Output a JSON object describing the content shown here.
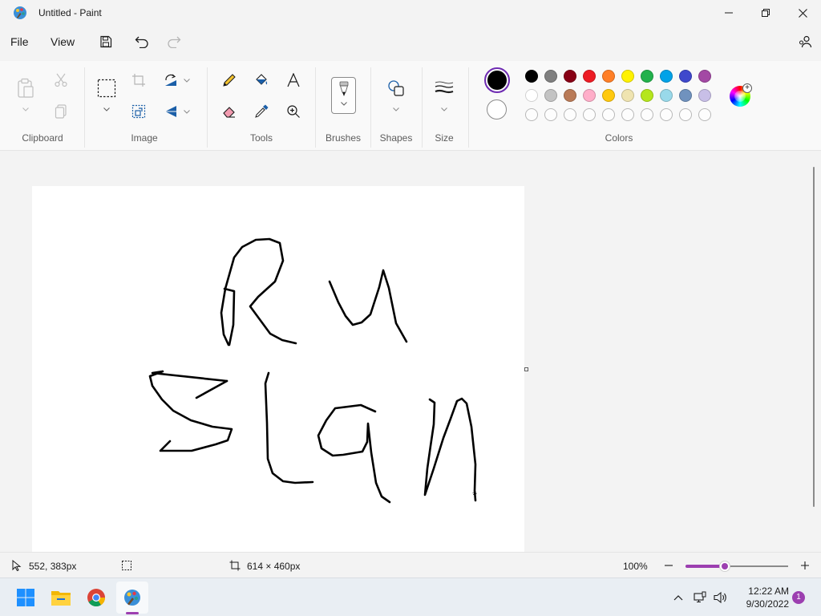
{
  "window": {
    "title": "Untitled - Paint",
    "controls": [
      "minimize-icon",
      "maximize-icon",
      "close-icon"
    ]
  },
  "menu": {
    "file": "File",
    "view": "View",
    "icons": [
      "save-icon",
      "undo-icon",
      "redo-icon",
      "share-icon"
    ]
  },
  "ribbon": {
    "groups": {
      "clipboard": "Clipboard",
      "image": "Image",
      "tools": "Tools",
      "brushes": "Brushes",
      "shapes": "Shapes",
      "size": "Size",
      "colors": "Colors"
    },
    "accent_color": "#9c3fb0",
    "primary_color": "#000000",
    "secondary_color": "#ffffff",
    "palette_row1": [
      "#000000",
      "#7f7f7f",
      "#880015",
      "#ed1c24",
      "#ff7f27",
      "#fff200",
      "#22b14c",
      "#00a2e8",
      "#3f48cc",
      "#a349a4"
    ],
    "palette_row2": [
      "#ffffff",
      "#c3c3c3",
      "#b97a57",
      "#ffaec9",
      "#ffc90e",
      "#efe4b0",
      "#b5e61d",
      "#99d9ea",
      "#7092be",
      "#c8bfe7"
    ],
    "palette_row3_count": 10
  },
  "status": {
    "cursor_position": "552, 383px",
    "canvas_size": "614 × 460px",
    "zoom": "100%",
    "zoom_level": 0.38
  },
  "taskbar": {
    "apps": [
      "windows-start-icon",
      "file-explorer-icon",
      "chrome-icon",
      "paint-icon"
    ],
    "time": "12:22 AM",
    "date": "9/30/2022",
    "notification_count": "1"
  }
}
